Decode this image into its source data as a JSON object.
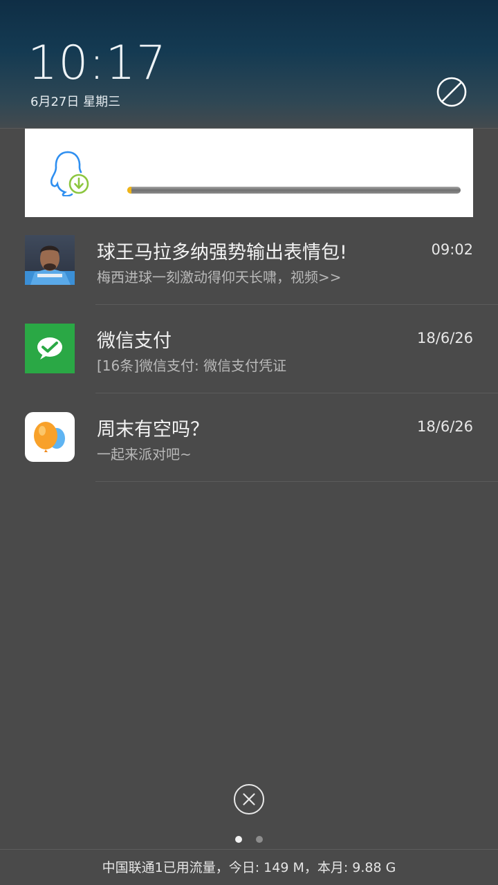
{
  "status": {
    "time": "10:17",
    "date": "6月27日 星期三"
  },
  "download": {
    "app_icon": "qq-download-icon",
    "progress": 0.01
  },
  "notifications": [
    {
      "title": "球王马拉多纳强势输出表情包!",
      "subtitle": "梅西进球一刻激动得仰天长啸，视频>>",
      "time": "09:02",
      "icon": "news-thumbnail"
    },
    {
      "title": "微信支付",
      "subtitle": "[16条]微信支付: 微信支付凭证",
      "time": "18/6/26",
      "icon": "wechat-pay-icon"
    },
    {
      "title": "周末有空吗？",
      "subtitle": "一起来派对吧~",
      "time": "18/6/26",
      "icon": "balloon-app-icon"
    }
  ],
  "footer": {
    "data_usage": "中国联通1已用流量，今日: 149 M，本月: 9.88 G"
  },
  "pager": {
    "pages": 2,
    "current": 1
  },
  "colors": {
    "background": "#4a4a4a",
    "progress_accent": "#f1b516",
    "wechat_green": "#2aa845",
    "qq_blue": "#2f8ff0"
  }
}
